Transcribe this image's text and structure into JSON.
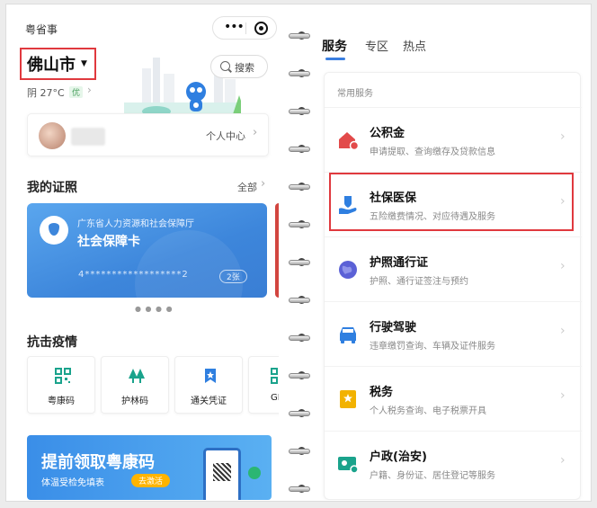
{
  "app": {
    "title": "粤省事"
  },
  "location": {
    "city": "佛山市",
    "weather": "阴 27°C",
    "air_quality": "优"
  },
  "search": {
    "label": "搜索"
  },
  "user": {
    "center_link": "个人中心"
  },
  "licenses": {
    "title": "我的证照",
    "all_link": "全部",
    "card": {
      "issuer": "广东省人力资源和社会保障厅",
      "name": "社会保障卡",
      "number": "4******************2",
      "count": "2张"
    }
  },
  "epidemic": {
    "title": "抗击疫情",
    "items": [
      {
        "label": "粤康码",
        "icon": "qr-code-icon"
      },
      {
        "label": "护林码",
        "icon": "forest-tree-icon"
      },
      {
        "label": "通关凭证",
        "icon": "pass-badge-icon"
      },
      {
        "label": "GI",
        "icon": "qr-code-icon"
      }
    ]
  },
  "banner": {
    "title": "提前领取粤康码",
    "subtitle": "体温受检免填表",
    "button": "去激活"
  },
  "tabs": [
    {
      "label": "服务",
      "active": true
    },
    {
      "label": "专区",
      "active": false
    },
    {
      "label": "热点",
      "active": false
    }
  ],
  "services": {
    "section_label": "常用服务",
    "items": [
      {
        "name": "公积金",
        "desc": "申请提取、查询缴存及贷款信息",
        "icon": "house-icon",
        "color": "#e24a4a"
      },
      {
        "name": "社保医保",
        "desc": "五险缴费情况、对应待遇及服务",
        "icon": "hand-shield-icon",
        "color": "#2f7fe0"
      },
      {
        "name": "护照通行证",
        "desc": "护照、通行证签注与预约",
        "icon": "globe-icon",
        "color": "#5b61d6"
      },
      {
        "name": "行驶驾驶",
        "desc": "违章缴罚查询、车辆及证件服务",
        "icon": "car-icon",
        "color": "#2f7fe0"
      },
      {
        "name": "税务",
        "desc": "个人税务查询、电子税票开具",
        "icon": "tax-icon",
        "color": "#f2b200"
      },
      {
        "name": "户政(治安)",
        "desc": "户籍、身份证、居住登记等服务",
        "icon": "id-card-icon",
        "color": "#1aa38c"
      }
    ]
  },
  "colors": {
    "accent": "#3a7ee0",
    "highlight_box": "#e0393e",
    "card_blue": "#3d86db"
  }
}
